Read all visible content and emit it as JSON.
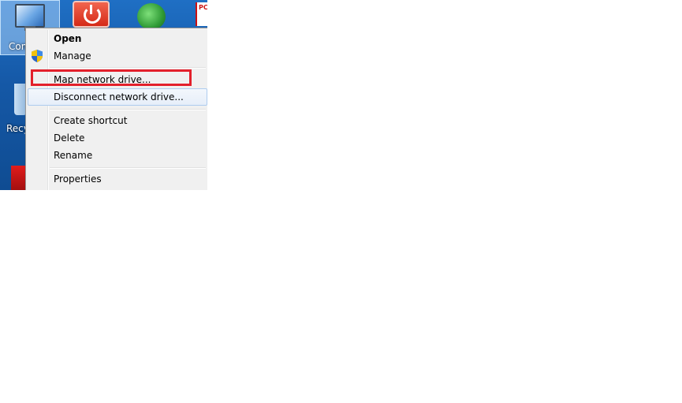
{
  "desktop": {
    "icons": [
      {
        "name": "computer",
        "label": "Con"
      },
      {
        "name": "recycle-bin",
        "label": "Recy"
      },
      {
        "name": "pdf",
        "label": "PC"
      }
    ]
  },
  "context_menu": {
    "items": [
      {
        "label": "Open",
        "bold": true
      },
      {
        "label": "Manage",
        "icon": "uac-shield-icon"
      },
      {
        "label": "Map network drive...",
        "highlighted_by_annotation": true
      },
      {
        "label": "Disconnect network drive...",
        "hovered": true
      },
      {
        "label": "Create shortcut"
      },
      {
        "label": "Delete"
      },
      {
        "label": "Rename"
      },
      {
        "label": "Properties"
      }
    ]
  },
  "colors": {
    "annotation_box": "#e3202b",
    "hover_border": "#aeccef",
    "menu_background": "#f0f0f0",
    "desktop_blue": "#1558a6"
  }
}
